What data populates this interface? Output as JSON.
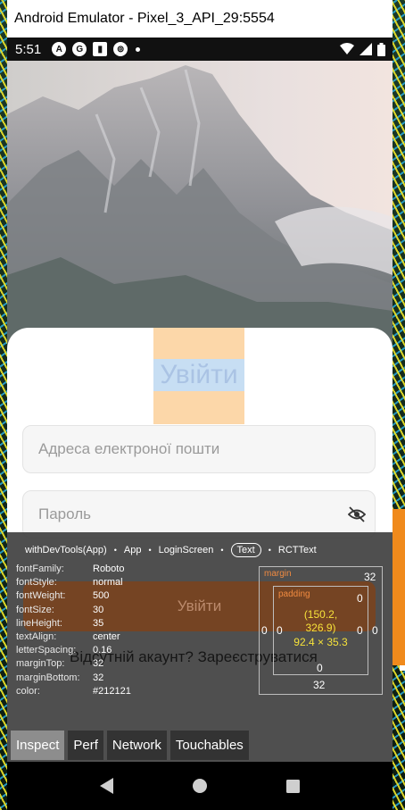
{
  "window": {
    "title": "Android Emulator - Pixel_3_API_29:5554"
  },
  "statusbar": {
    "time": "5:51",
    "notif_icons": [
      "A",
      "G",
      "▮",
      "⊚"
    ]
  },
  "login": {
    "title": "Увійти",
    "email_placeholder": "Адреса електроної пошти",
    "password_placeholder": "Пароль",
    "submit_label": "Увійти",
    "register_text": "Відсутній акаунт? Зареєструватися"
  },
  "devtools": {
    "breadcrumbs": [
      "withDevTools(App)",
      "App",
      "LoginScreen",
      "Text",
      "RCTText"
    ],
    "active_crumb": "Text",
    "styles": [
      {
        "key": "fontFamily:",
        "value": "Roboto"
      },
      {
        "key": "fontStyle:",
        "value": "normal"
      },
      {
        "key": "fontWeight:",
        "value": "500"
      },
      {
        "key": "fontSize:",
        "value": "30"
      },
      {
        "key": "lineHeight:",
        "value": "35"
      },
      {
        "key": "textAlign:",
        "value": "center"
      },
      {
        "key": "letterSpacing:",
        "value": "0.16"
      },
      {
        "key": "marginTop:",
        "value": "32"
      },
      {
        "key": "marginBottom:",
        "value": "32"
      },
      {
        "key": "color:",
        "value": "#212121"
      }
    ],
    "box_model": {
      "margin_label": "margin",
      "padding_label": "padding",
      "margin_top": "32",
      "margin_bottom": "32",
      "margin_left": "0",
      "margin_right": "0",
      "padding_top": "0",
      "padding_bottom": "0",
      "padding_left": "0",
      "padding_right": "0",
      "position_line1": "(150.2,",
      "position_line2": "326.9)",
      "size": "92.4 × 35.3"
    },
    "tabs": [
      "Inspect",
      "Perf",
      "Network",
      "Touchables"
    ],
    "active_tab": "Inspect"
  },
  "colors": {
    "margin_highlight": "#fcd7a9",
    "content_highlight": "#c7def3",
    "devtools_bg": "#424242",
    "accent_orange": "#f08a40",
    "value_yellow": "#f6e23a"
  }
}
